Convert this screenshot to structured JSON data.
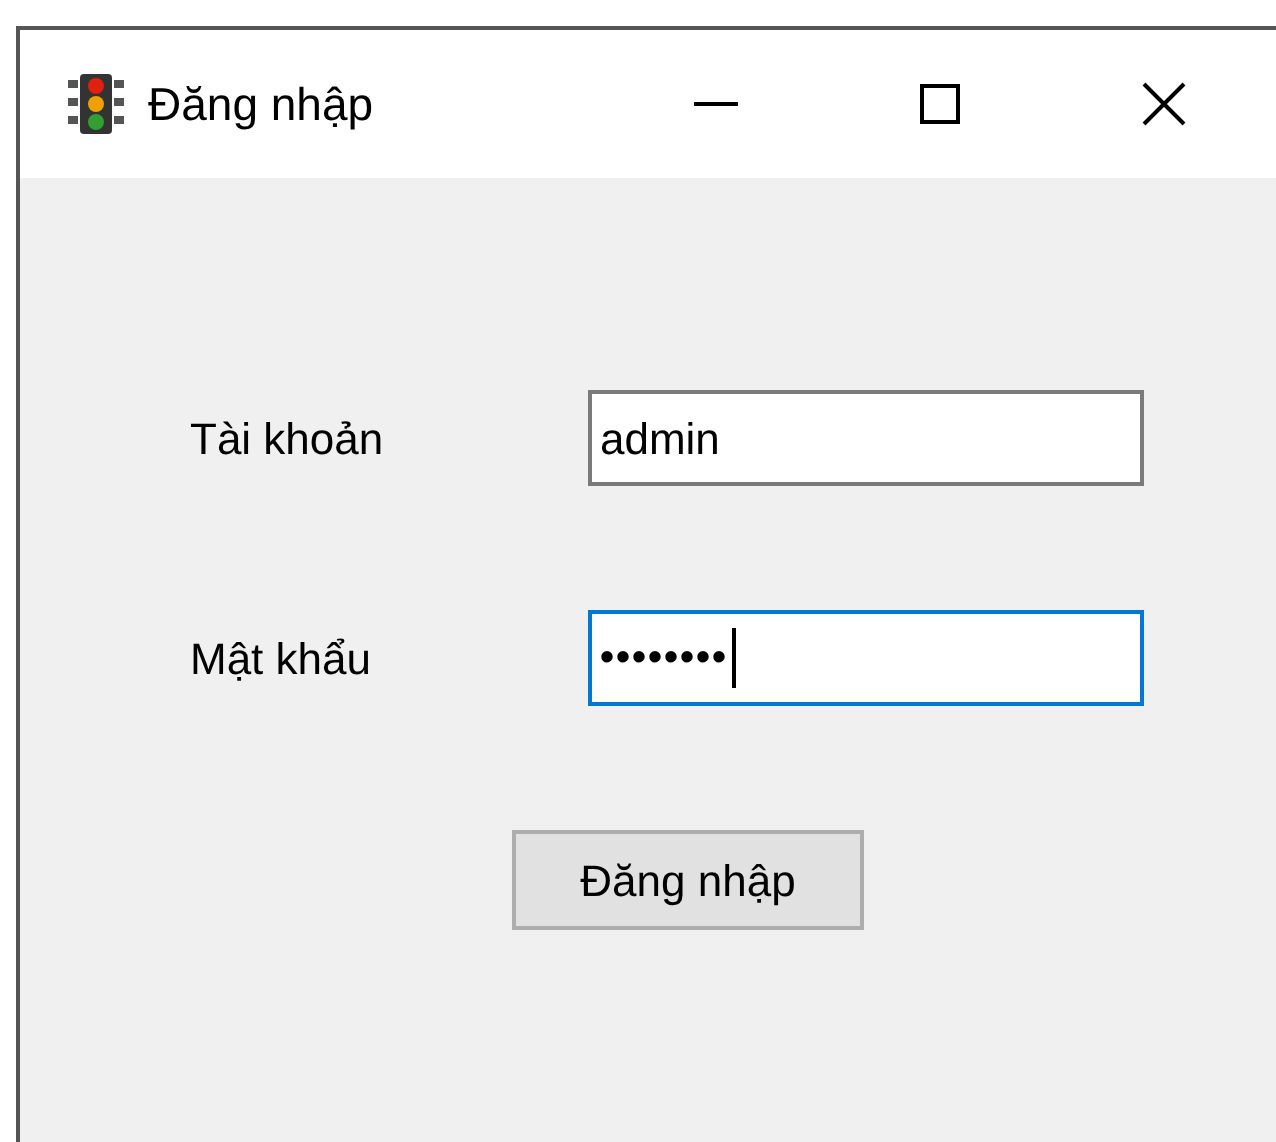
{
  "window": {
    "title": "Đăng nhập"
  },
  "fields": [
    {
      "label": "Tài khoản",
      "value": "admin",
      "focused": false
    },
    {
      "label": "Mật khẩu",
      "value": "••••••••",
      "focused": true
    }
  ],
  "buttons": [
    "Đăng nhập"
  ]
}
